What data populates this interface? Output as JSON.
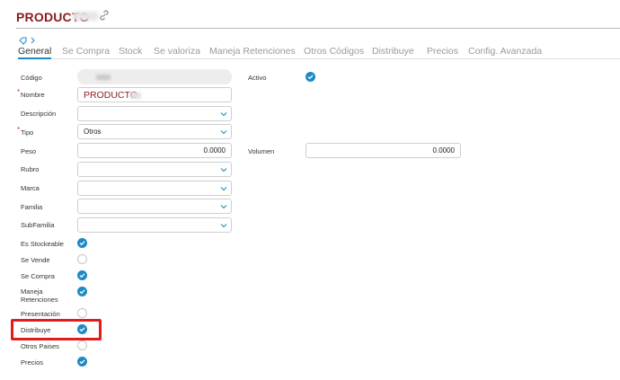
{
  "header": {
    "title": "PRODUCTO"
  },
  "tabs": [
    {
      "label": "General",
      "active": true
    },
    {
      "label": "Se Compra"
    },
    {
      "label": "Stock"
    },
    {
      "label": "Se valoriza"
    },
    {
      "label": "Maneja Retenciones"
    },
    {
      "label": "Otros Códigos"
    },
    {
      "label": "Distribuye"
    },
    {
      "label": "Precios"
    },
    {
      "label": "Config. Avanzada"
    }
  ],
  "form": {
    "codigo": {
      "label": "Código",
      "value": ""
    },
    "activo": {
      "label": "Activo",
      "checked": true
    },
    "nombre": {
      "label": "Nombre",
      "value": "PRODUCTO",
      "required": true
    },
    "descripcion": {
      "label": "Descripción",
      "value": ""
    },
    "tipo": {
      "label": "Tipo",
      "value": "Otros",
      "required": true
    },
    "peso": {
      "label": "Peso",
      "value": "0.0000"
    },
    "volumen": {
      "label": "Volumen",
      "value": "0.0000"
    },
    "rubro": {
      "label": "Rubro",
      "value": ""
    },
    "marca": {
      "label": "Marca",
      "value": ""
    },
    "familia": {
      "label": "Familia",
      "value": ""
    },
    "subfamilia": {
      "label": "SubFamilia",
      "value": ""
    },
    "checks": [
      {
        "label": "Es Stockeable",
        "checked": true
      },
      {
        "label": "Se Vende",
        "checked": false
      },
      {
        "label": "Se Compra",
        "checked": true
      },
      {
        "label": "Maneja Retenciones",
        "checked": true
      },
      {
        "label": "Presentación",
        "checked": false
      },
      {
        "label": "Distribuye",
        "checked": true
      },
      {
        "label": "Otros Paises",
        "checked": false
      },
      {
        "label": "Precios",
        "checked": true
      }
    ]
  },
  "colors": {
    "accent": "#1e8ac4",
    "title": "#8b1a1a",
    "highlight": "#e21b1b",
    "required": "#d32f2f"
  }
}
